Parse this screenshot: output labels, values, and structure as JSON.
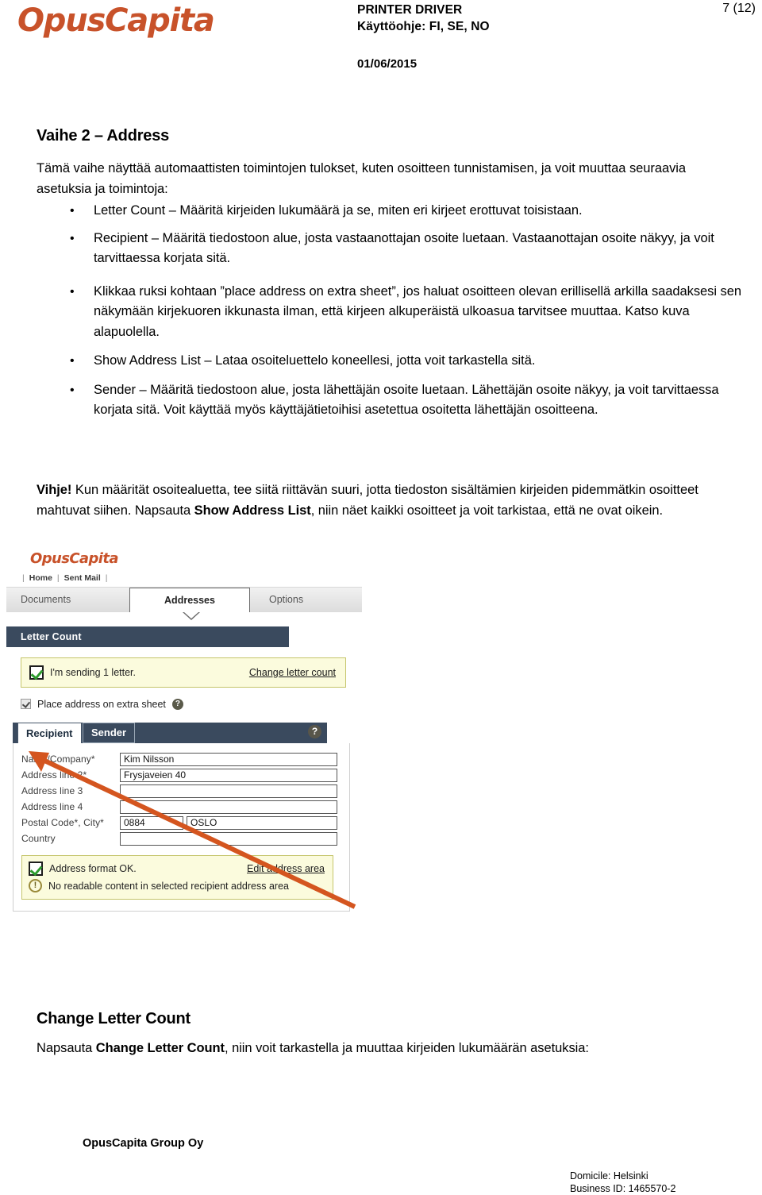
{
  "header": {
    "logo": "OpusCapita",
    "doc_title": "PRINTER DRIVER",
    "doc_subtitle": "Käyttöohje: FI, SE, NO",
    "date": "01/06/2015",
    "page_number": "7 (12)"
  },
  "section": {
    "title": "Vaihe 2 – Address",
    "intro": "Tämä vaihe näyttää automaattisten toimintojen tulokset, kuten osoitteen tunnistamisen, ja voit muuttaa seuraavia asetuksia ja toimintoja:",
    "bullets": [
      "Letter Count – Määritä kirjeiden lukumäärä ja se, miten eri kirjeet erottuvat toisistaan.",
      "Recipient – Määritä tiedostoon alue, josta vastaanottajan osoite luetaan. Vastaanottajan osoite näkyy, ja voit tarvittaessa korjata sitä.",
      "Klikkaa ruksi kohtaan ”place address on extra sheet”, jos haluat osoitteen olevan erillisellä arkilla saadaksesi sen näkymään kirjekuoren ikkunasta ilman, että kirjeen alkuperäistä ulkoasua tarvitsee muuttaa. Katso kuva alapuolella.",
      "Show Address List – Lataa osoiteluettelo koneellesi, jotta voit tarkastella sitä.",
      "Sender – Määritä tiedostoon alue, josta lähettäjän osoite luetaan. Lähettäjän osoite näkyy, ja voit tarvittaessa korjata sitä. Voit käyttää myös käyttäjätietoihisi asetettua osoitetta lähettäjän osoitteena."
    ]
  },
  "tip": {
    "label": "Vihje!",
    "text_part1": " Kun määrität osoitealuetta, tee siitä riittävän suuri, jotta tiedoston sisältämien kirjeiden pidemmätkin osoitteet mahtuvat siihen. Napsauta ",
    "bold_term": "Show Address List",
    "text_part2": ", niin näet kaikki osoitteet ja voit tarkistaa, että ne ovat oikein."
  },
  "app": {
    "logo": "OpusCapita",
    "nav": {
      "home": "Home",
      "sent_mail": "Sent Mail",
      "separator": "|"
    },
    "tabs": [
      {
        "label": "Documents",
        "active": false
      },
      {
        "label": "Addresses",
        "active": true
      },
      {
        "label": "Options",
        "active": false
      }
    ],
    "letter_count": {
      "panel_title": "Letter Count",
      "status_message": "I'm sending 1 letter.",
      "change_link": "Change letter count",
      "extra_sheet_label": "Place address on extra sheet",
      "help_glyph": "?"
    },
    "address": {
      "tab_recipient": "Recipient",
      "tab_sender": "Sender",
      "help_glyph": "?",
      "fields": [
        {
          "label": "Name/Company*",
          "value": "Kim Nilsson"
        },
        {
          "label": "Address line 2*",
          "value": "Frysjaveien 40"
        },
        {
          "label": "Address line 3",
          "value": ""
        },
        {
          "label": "Address line 4",
          "value": ""
        }
      ],
      "postal_label": "Postal Code*, City*",
      "postal_code": "0884",
      "city": "OSLO",
      "country_label": "Country",
      "country_value": "",
      "status_ok": "Address format OK.",
      "edit_link": "Edit address area",
      "status_warning": "No readable content in selected recipient address area"
    }
  },
  "bottom_section": {
    "title": "Change Letter Count",
    "text_part1": "Napsauta ",
    "bold_term": "Change Letter Count",
    "text_part2": ", niin voit tarkastella ja muuttaa kirjeiden lukumäärän asetuksia:"
  },
  "footer": {
    "company": "OpusCapita Group Oy",
    "domicile": "Domicile: Helsinki",
    "business_id": "Business ID: 1465570-2"
  },
  "colors": {
    "brand_orange": "#C8522A",
    "panel_navy": "#3A4A5E",
    "info_yellow_bg": "#FBFBDD",
    "info_yellow_border": "#C5C56B",
    "check_green": "#2E9B2E",
    "arrow_orange": "#D4551F"
  }
}
